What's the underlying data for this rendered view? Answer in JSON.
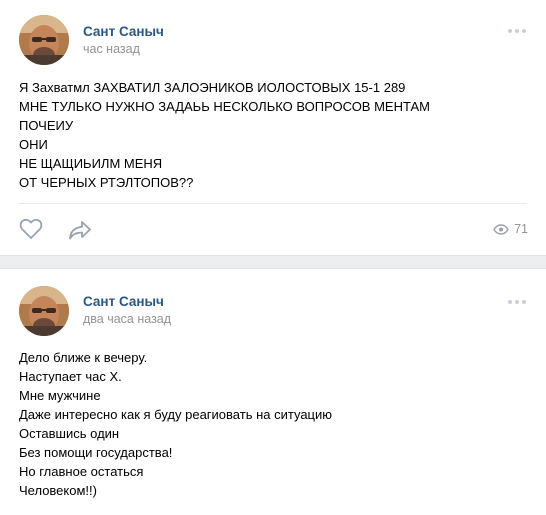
{
  "posts": [
    {
      "author": "Сант Саныч",
      "time": "час назад",
      "lines": [
        "Я Захватмл ЗАХВАТИЛ ЗАЛОЭНИКОВ ИОЛОСТОВЫХ 15-1 289",
        "МНЕ ТУЛЬКО НУЖНО ЗАДАЬЬ НЕСКОЛЬКО ВОПРОСОВ МЕНТАМ",
        "ПОЧЕИУ",
        "ОНИ",
        "НЕ ЩАЩИЬИЛМ МЕНЯ",
        "ОТ ЧЕРНЫХ РТЭЛТОПОВ??"
      ],
      "views": "71"
    },
    {
      "author": "Сант Саныч",
      "time": "два часа назад",
      "lines": [
        "Дело ближе к вечеру.",
        "Наступает час Х.",
        "Мне мужчине",
        "Даже интересно как я буду реагиовать на ситуацию",
        "Оставшись один",
        "Без помощи государства!",
        "Но главное остаться",
        "Человеком!!)"
      ]
    }
  ],
  "icons": {
    "like": "heart-icon",
    "share": "share-arrow-icon",
    "views": "eye-icon",
    "more": "more-dots-icon"
  },
  "colors": {
    "author": "#2a5885",
    "meta": "#939393",
    "icon": "#99a2ad",
    "background": "#edeef0"
  }
}
